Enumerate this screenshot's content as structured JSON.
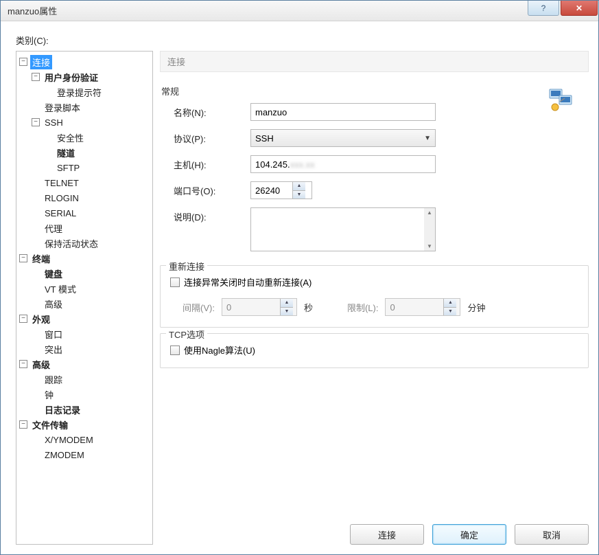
{
  "window": {
    "title": "manzuo属性"
  },
  "category_label": "类别(C):",
  "tree": {
    "connection": "连接",
    "user_auth": "用户身份验证",
    "login_prompt": "登录提示符",
    "login_script": "登录脚本",
    "ssh": "SSH",
    "security": "安全性",
    "tunnel": "隧道",
    "sftp": "SFTP",
    "telnet": "TELNET",
    "rlogin": "RLOGIN",
    "serial": "SERIAL",
    "proxy": "代理",
    "keepalive": "保持活动状态",
    "terminal": "终端",
    "keyboard": "键盘",
    "vt_mode": "VT 模式",
    "term_advanced": "高级",
    "appearance": "外观",
    "window": "窗口",
    "popout": "突出",
    "advanced": "高级",
    "trace": "跟踪",
    "bell": "钟",
    "logging": "日志记录",
    "file_transfer": "文件传输",
    "xymodem": "X/YMODEM",
    "zmodem": "ZMODEM"
  },
  "panel": {
    "section_title": "连接",
    "general_label": "常规",
    "name_label": "名称(N):",
    "name_value": "manzuo",
    "protocol_label": "协议(P):",
    "protocol_value": "SSH",
    "host_label": "主机(H):",
    "host_prefix": "104.245.",
    "host_blur": "xxx.xx",
    "port_label": "端口号(O):",
    "port_value": "26240",
    "desc_label": "说明(D):",
    "desc_value": ""
  },
  "reconnect": {
    "group_label": "重新连接",
    "auto_label": "连接异常关闭时自动重新连接(A)",
    "interval_label": "间隔(V):",
    "interval_value": "0",
    "interval_unit": "秒",
    "limit_label": "限制(L):",
    "limit_value": "0",
    "limit_unit": "分钟"
  },
  "tcp": {
    "group_label": "TCP选项",
    "nagle_label": "使用Nagle算法(U)"
  },
  "buttons": {
    "connect": "连接",
    "ok": "确定",
    "cancel": "取消"
  }
}
